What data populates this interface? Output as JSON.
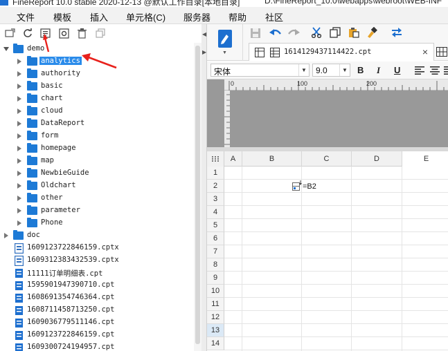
{
  "window": {
    "title": "FineReport 10.0 stable 2020-12-13 @默认工作目录[本地目录]",
    "path": "D:\\FineReport_10.0\\webapps\\webroot\\WEB-INF"
  },
  "menu": {
    "items": [
      "文件",
      "模板",
      "插入",
      "单元格(C)",
      "服务器",
      "帮助",
      "社区"
    ]
  },
  "left_toolbar": {
    "icons": [
      "new-folder-icon",
      "refresh-icon",
      "show-icon",
      "settings-icon",
      "delete-icon",
      "copy-icon"
    ]
  },
  "tree": {
    "root": "demo",
    "children": [
      "analytics",
      "authority",
      "basic",
      "chart",
      "cloud",
      "DataReport",
      "form",
      "homepage",
      "map",
      "NewbieGuide",
      "Oldchart",
      "other",
      "parameter",
      "Phone"
    ],
    "selected": "analytics",
    "second_root": "doc",
    "files": [
      "1609123722846159.cptx",
      "1609312383432539.cptx",
      "11111订单明细表.cpt",
      "1595901947390710.cpt",
      "1608691354746364.cpt",
      "1608711458713250.cpt",
      "1609036779511146.cpt",
      "1609123722846159.cpt",
      "1609300724194957.cpt"
    ]
  },
  "tab": {
    "label": "1614129437114422.cpt",
    "close": "×"
  },
  "fontbar": {
    "font_name": "宋体",
    "font_size": "9.0",
    "bold": "B",
    "italic": "I",
    "underline": "U"
  },
  "ruler": {
    "marks": [
      "0",
      "100",
      "200"
    ]
  },
  "sheet": {
    "columns": [
      "A",
      "B",
      "C",
      "D",
      "E"
    ],
    "rows": [
      "1",
      "2",
      "3",
      "4",
      "5",
      "6",
      "7",
      "8",
      "9",
      "10",
      "11",
      "12",
      "13",
      "14"
    ],
    "highlighted_row": "13",
    "cell_C2": "=B2"
  }
}
